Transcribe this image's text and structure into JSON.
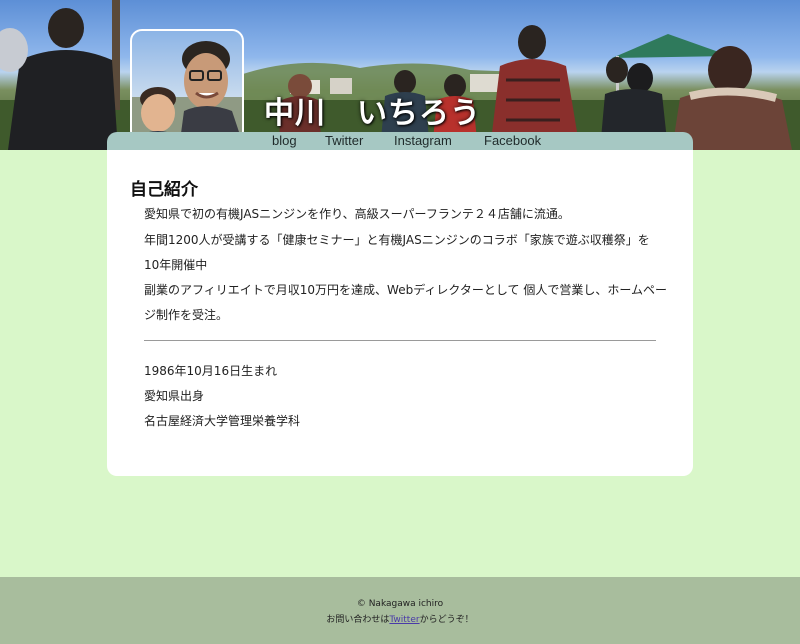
{
  "header": {
    "site_title": "中川　いちろう",
    "nav": [
      {
        "label": "blog"
      },
      {
        "label": "Twitter"
      },
      {
        "label": "Instagram"
      },
      {
        "label": "Facebook"
      }
    ]
  },
  "main": {
    "heading": "自己紹介",
    "intro_lines": [
      "愛知県で初の有機JASニンジンを作り、高級スーパーフランテ２４店舗に流通。",
      "年間1200人が受講する「健康セミナー」と有機JASニンジンのコラボ「家族で遊ぶ収穫祭」を",
      "10年開催中",
      "副業のアフィリエイトで月収10万円を達成、Webディレクターとして 個人で営業し、ホームペー",
      "ジ制作を受注。"
    ],
    "profile_lines": [
      "1986年10月16日生まれ",
      "愛知県出身",
      "名古屋経済大学管理栄養学科"
    ]
  },
  "footer": {
    "copyright": "© Nakagawa ichiro",
    "contact_prefix": "お問い合わせは",
    "contact_link": "Twitter",
    "contact_suffix": "からどうぞ！"
  },
  "colors": {
    "page_background": "#d9f7c9",
    "nav_bar": "#a6c8c3",
    "footer_background": "#a8bd9d",
    "card_background": "#ffffff"
  }
}
